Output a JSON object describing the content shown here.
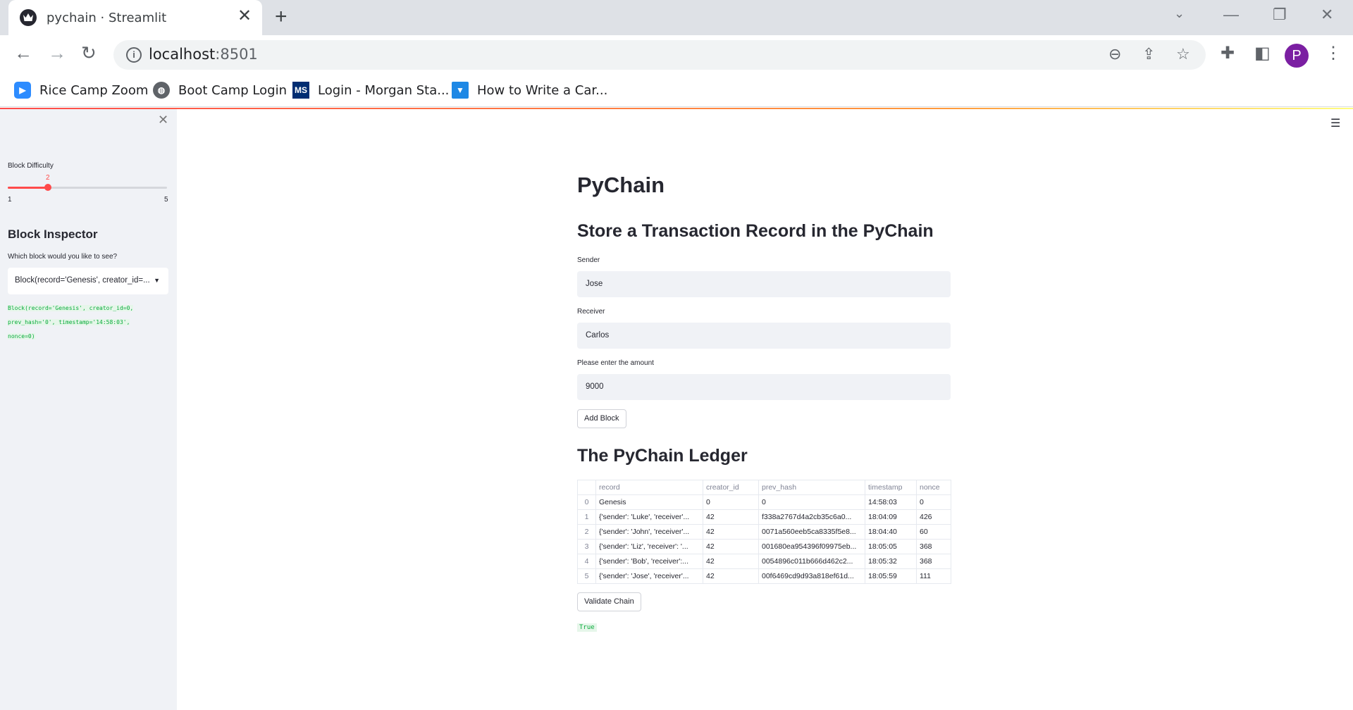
{
  "browser": {
    "tab_title": "pychain · Streamlit",
    "url_host": "localhost",
    "url_port": ":8501",
    "avatar_letter": "P",
    "bookmarks": [
      {
        "label": "Rice Camp Zoom",
        "icon": "zoom-icon"
      },
      {
        "label": "Boot Camp Login",
        "icon": "globe-icon"
      },
      {
        "label": "Login - Morgan Sta...",
        "icon": "ms-icon"
      },
      {
        "label": "How to Write a Car...",
        "icon": "tie-icon"
      }
    ]
  },
  "sidebar": {
    "slider": {
      "label": "Block Difficulty",
      "value": "2",
      "min": "1",
      "max": "5"
    },
    "inspector_title": "Block Inspector",
    "select_label": "Which block would you like to see?",
    "select_value": "Block(record='Genesis', creator_id=...",
    "block_output_lines": [
      "Block(record='Genesis', creator_id=0,",
      "prev_hash='0', timestamp='14:58:03',",
      "nonce=0)"
    ]
  },
  "main": {
    "title": "PyChain",
    "form_title": "Store a Transaction Record in the PyChain",
    "sender_label": "Sender",
    "sender_value": "Jose",
    "receiver_label": "Receiver",
    "receiver_value": "Carlos",
    "amount_label": "Please enter the amount",
    "amount_value": "9000",
    "add_block_label": "Add Block",
    "ledger_title": "The PyChain Ledger",
    "ledger_columns": [
      "",
      "record",
      "creator_id",
      "prev_hash",
      "timestamp",
      "nonce"
    ],
    "ledger_rows": [
      [
        "0",
        "Genesis",
        "0",
        "0",
        "14:58:03",
        "0"
      ],
      [
        "1",
        "{'sender': 'Luke', 'receiver'...",
        "42",
        "f338a2767d4a2cb35c6a0...",
        "18:04:09",
        "426"
      ],
      [
        "2",
        "{'sender': 'John', 'receiver'...",
        "42",
        "0071a560eeb5ca8335f5e8...",
        "18:04:40",
        "60"
      ],
      [
        "3",
        "{'sender': 'Liz', 'receiver': '...",
        "42",
        "001680ea954396f09975eb...",
        "18:05:05",
        "368"
      ],
      [
        "4",
        "{'sender': 'Bob', 'receiver':...",
        "42",
        "0054896c011b666d462c2...",
        "18:05:32",
        "368"
      ],
      [
        "5",
        "{'sender': 'Jose', 'receiver'...",
        "42",
        "00f6469cd9d93a818ef61d...",
        "18:05:59",
        "111"
      ]
    ],
    "validate_label": "Validate Chain",
    "validation_result": "True"
  },
  "colors": {
    "accent": "#ff4b4b",
    "success_text": "#09ab3b",
    "sidebar_bg": "#f0f2f6"
  }
}
